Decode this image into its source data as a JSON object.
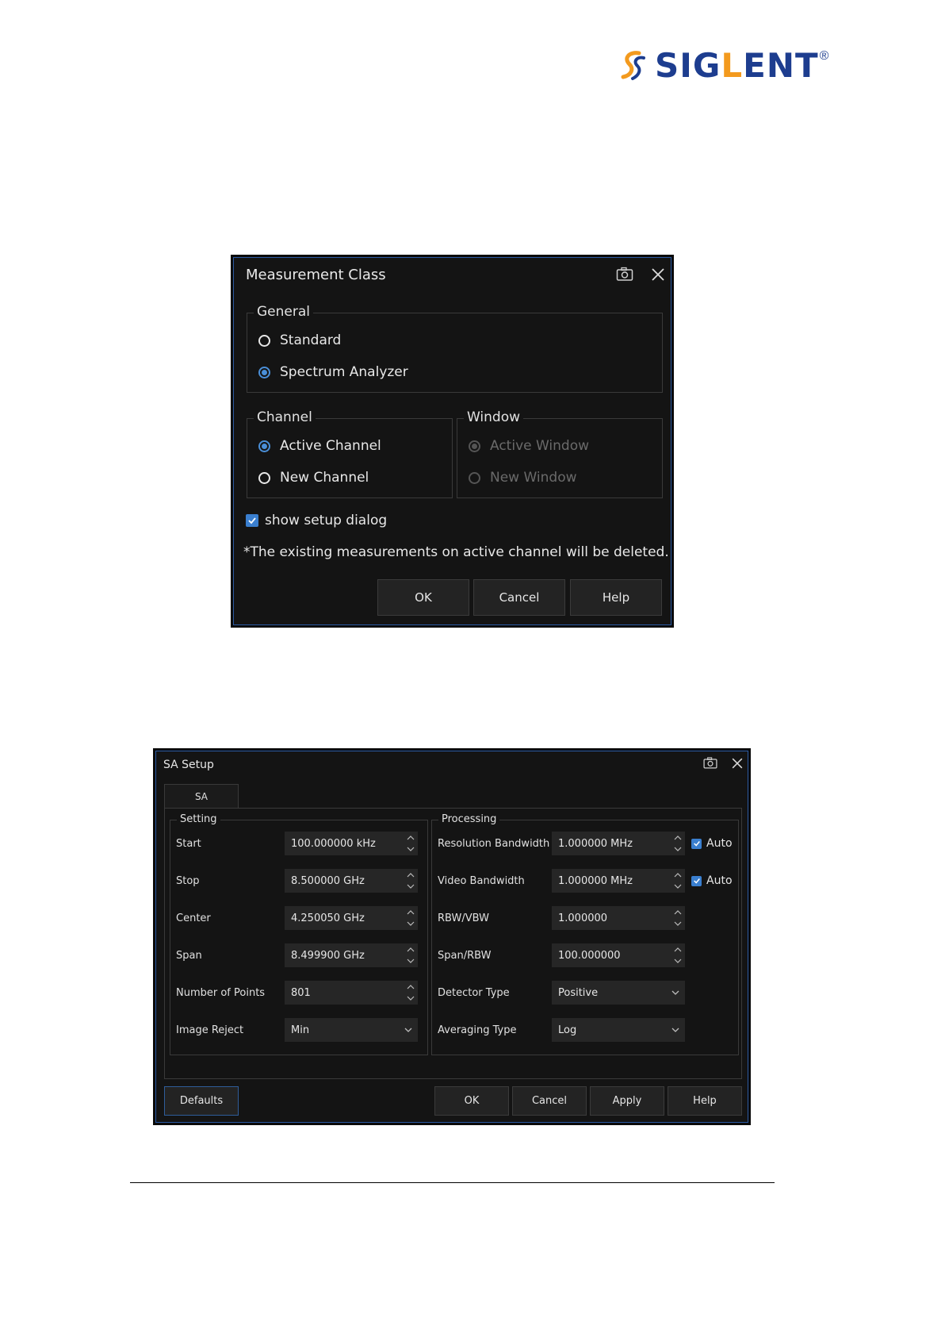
{
  "logo": {
    "text_main": "SIG",
    "text_accent": "L",
    "text_end": "ENT",
    "reg": "®",
    "colors": {
      "blue": "#1d3d8f",
      "orange": "#f39a1e"
    }
  },
  "measurement_class": {
    "title": "Measurement Class",
    "general": {
      "label": "General",
      "options": [
        {
          "label": "Standard",
          "checked": false
        },
        {
          "label": "Spectrum Analyzer",
          "checked": true
        }
      ]
    },
    "channel": {
      "label": "Channel",
      "options": [
        {
          "label": "Active Channel",
          "checked": true
        },
        {
          "label": "New Channel",
          "checked": false
        }
      ]
    },
    "window": {
      "label": "Window",
      "options": [
        {
          "label": "Active Window",
          "checked": true,
          "disabled": true
        },
        {
          "label": "New Window",
          "checked": false,
          "disabled": true
        }
      ]
    },
    "show_setup": {
      "label": "show setup dialog",
      "checked": true
    },
    "note": "*The existing measurements on active channel will be deleted.",
    "buttons": {
      "ok": "OK",
      "cancel": "Cancel",
      "help": "Help"
    }
  },
  "sa_setup": {
    "title": "SA Setup",
    "tab": "SA",
    "setting": {
      "label": "Setting",
      "rows": [
        {
          "label": "Start",
          "value": "100.000000 kHz",
          "control": "spin"
        },
        {
          "label": "Stop",
          "value": "8.500000 GHz",
          "control": "spin"
        },
        {
          "label": "Center",
          "value": "4.250050 GHz",
          "control": "spin"
        },
        {
          "label": "Span",
          "value": "8.499900 GHz",
          "control": "spin"
        },
        {
          "label": "Number of Points",
          "value": "801",
          "control": "spin"
        },
        {
          "label": "Image Reject",
          "value": "Min",
          "control": "dropdown"
        }
      ]
    },
    "processing": {
      "label": "Processing",
      "rows": [
        {
          "label": "Resolution Bandwidth",
          "value": "1.000000 MHz",
          "control": "spin",
          "auto": "Auto"
        },
        {
          "label": "Video Bandwidth",
          "value": "1.000000 MHz",
          "control": "spin",
          "auto": "Auto"
        },
        {
          "label": "RBW/VBW",
          "value": "1.000000",
          "control": "spin"
        },
        {
          "label": "Span/RBW",
          "value": "100.000000",
          "control": "spin"
        },
        {
          "label": "Detector Type",
          "value": "Positive",
          "control": "dropdown"
        },
        {
          "label": "Averaging Type",
          "value": "Log",
          "control": "dropdown"
        }
      ]
    },
    "buttons": {
      "defaults": "Defaults",
      "ok": "OK",
      "cancel": "Cancel",
      "apply": "Apply",
      "help": "Help"
    }
  },
  "icons": {
    "camera": "camera-icon",
    "close": "close-icon",
    "check": "check-icon",
    "spin": "spin-arrows-icon",
    "dropdown": "chevron-down-icon"
  }
}
